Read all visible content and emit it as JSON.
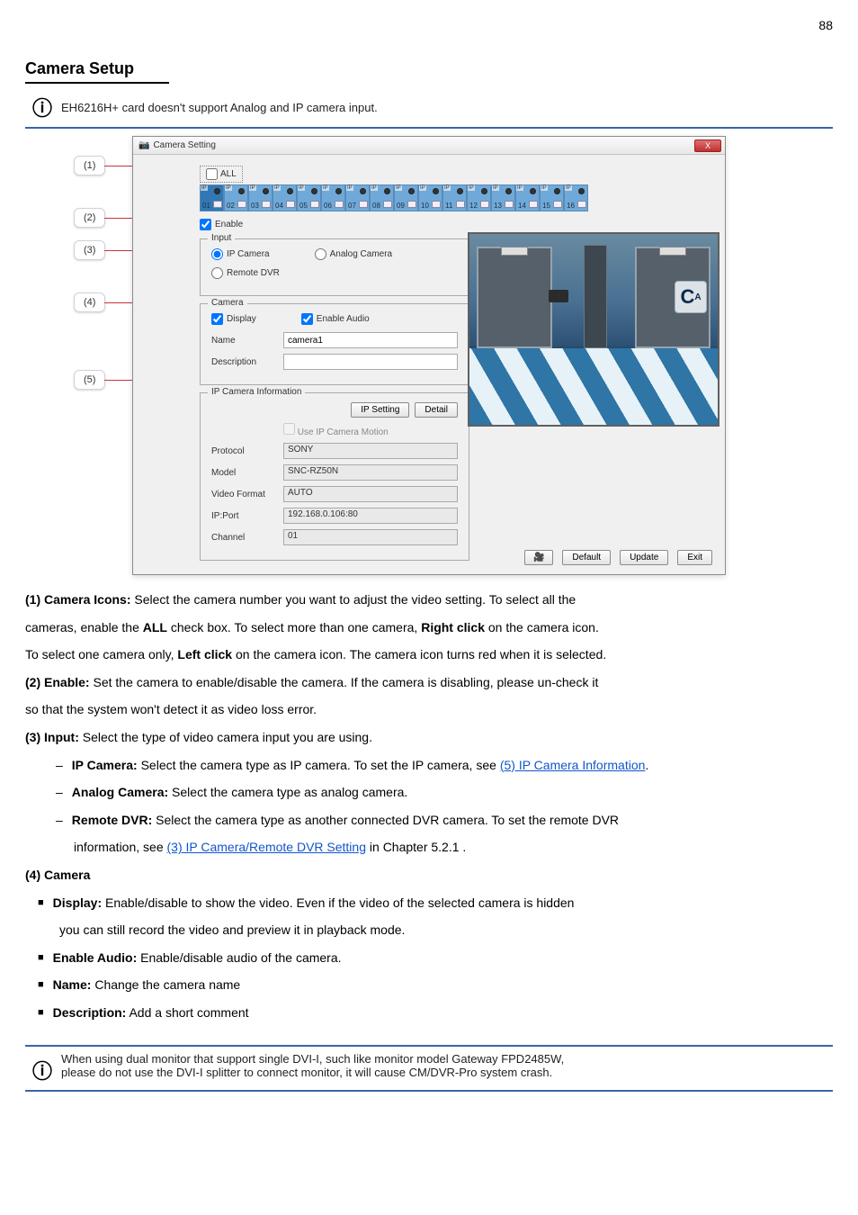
{
  "page_number": "88",
  "section_title": "Camera Setup",
  "top_note": "EH6216H+ card doesn't support Analog and IP camera input.",
  "dialog": {
    "title": "Camera Setting",
    "close": "X",
    "all_label": "ALL",
    "channel_numbers": [
      "01",
      "02",
      "03",
      "04",
      "05",
      "06",
      "07",
      "08",
      "09",
      "10",
      "11",
      "12",
      "13",
      "14",
      "15",
      "16"
    ],
    "enable_label": "Enable",
    "input_legend": "Input",
    "radio_ip": "IP Camera",
    "radio_analog": "Analog Camera",
    "radio_remote": "Remote DVR",
    "camera_legend": "Camera",
    "display": "Display",
    "enable_audio": "Enable Audio",
    "name_label": "Name",
    "name_value": "camera1",
    "desc_label": "Description",
    "desc_value": "",
    "ipinfo_legend": "IP Camera Information",
    "ip_setting_btn": "IP Setting",
    "detail_btn": "Detail",
    "use_ip_motion": "Use IP Camera Motion",
    "protocol_label": "Protocol",
    "protocol_value": "SONY",
    "model_label": "Model",
    "model_value": "SNC-RZ50N",
    "vformat_label": "Video Format",
    "vformat_value": "AUTO",
    "ipport_label": "IP:Port",
    "ipport_value": "192.168.0.106:80",
    "channel_label": "Channel",
    "channel_value": "01",
    "cam_overlay": "C",
    "cam_overlay_sub": "A",
    "bottom": {
      "default": "Default",
      "update": "Update",
      "exit": "Exit"
    }
  },
  "callouts": {
    "c1": "(1)",
    "c2": "(2)",
    "c3": "(3)",
    "c4": "(4)",
    "c5": "(5)"
  },
  "body": {
    "p1_a": "(1)",
    "p1_b": "Camera Icons:",
    "p1_c": " Select the camera number you want to adjust the video setting. To select all the",
    "p2": "cameras, enable the ",
    "p2b": "ALL",
    "p2c": " check box. To select more than one camera, ",
    "p2d": "Right click",
    "p2e": " on the camera icon.",
    "p3a": "To select one camera only, ",
    "p3b": "Left click",
    "p3c": " on the camera icon. The camera icon turns red when it is selected.",
    "p4a": "(2)",
    "p4b": "Enable:",
    "p4c": " Set the camera to enable/disable the camera. If the camera is disabling, please un-check it",
    "p5": "so that the system won't detect it as video loss error.",
    "p6a": "(3)",
    "p6b": "Input:",
    "p6c": " Select the type of video camera input you are using.",
    "p7a": "IP Camera:",
    "p7b": " Select the camera type as IP camera. To set the IP camera, see ",
    "p7c": "(5) IP Camera Information",
    "p7d": ".",
    "p8a": "Analog Camera:",
    "p8b": " Select the camera type as analog camera.",
    "p9a": "Remote DVR:",
    "p9b": " Select the camera type as another connected DVR camera. To set the remote DVR",
    "p10a": "information, see ",
    "p10b": "(3) IP Camera/Remote DVR Setting",
    "p10c": " in ",
    "p10d": "Chapter 5.2.1",
    "p10e": ".",
    "p11a": "(4)",
    "p11b": " Camera",
    "p12a": "Display:",
    "p12b": " Enable/disable to show the video. Even if the video of the selected camera is hidden",
    "p13": "you can still record the video and preview it in playback mode.",
    "p14a": "Enable Audio:",
    "p14b": " Enable/disable audio of the camera.",
    "p15a": "Name:",
    "p15b": " Change the camera name",
    "p16a": "Description:",
    "p16b": " Add a short comment",
    "foot_a": "When using dual monitor that support single DVI-I, such like monitor model Gateway FPD2485W,",
    "foot_b": "please do not use the DVI-I splitter to connect monitor, it will cause CM/DVR-Pro system crash."
  }
}
